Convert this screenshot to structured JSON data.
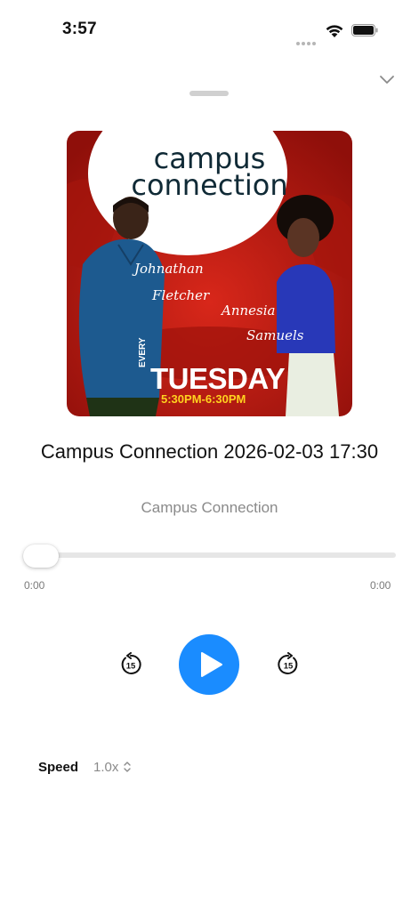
{
  "status_bar": {
    "time": "3:57"
  },
  "artwork": {
    "show_name_line1": "campus",
    "show_name_line2": "connection",
    "host1_first": "Johnathan",
    "host1_last": "Fletcher",
    "host2_first": "Annesia",
    "host2_last": "Samuels",
    "every": "EVERY",
    "day": "TUESDAY",
    "time_slot": "5:30PM-6:30PM",
    "colors": {
      "red": "#c61d12",
      "dark_red": "#8f0f0a",
      "yellow": "#ffd21f"
    }
  },
  "episode": {
    "title": "Campus Connection 2026-02-03 17:30",
    "podcast": "Campus Connection"
  },
  "progress": {
    "elapsed": "0:00",
    "duration": "0:00",
    "fraction": 0
  },
  "controls": {
    "rewind_seconds": "15",
    "forward_seconds": "15",
    "accent": "#1a8cff"
  },
  "speed": {
    "label": "Speed",
    "value": "1.0x"
  }
}
